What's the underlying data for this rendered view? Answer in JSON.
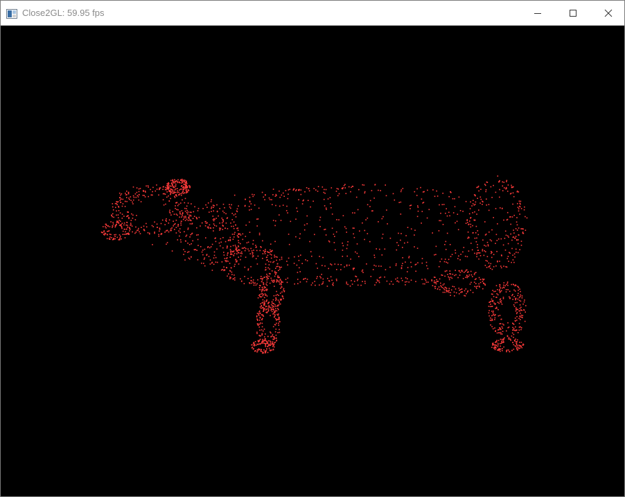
{
  "window": {
    "title": "Close2GL: 59.95 fps",
    "controls": {
      "minimize_icon": "minimize-icon",
      "maximize_icon": "maximize-icon",
      "close_icon": "close-icon"
    }
  },
  "viewport": {
    "background_color": "#000000",
    "point_color": "#ff3b3b",
    "render_mode": "points",
    "model": "cow"
  }
}
